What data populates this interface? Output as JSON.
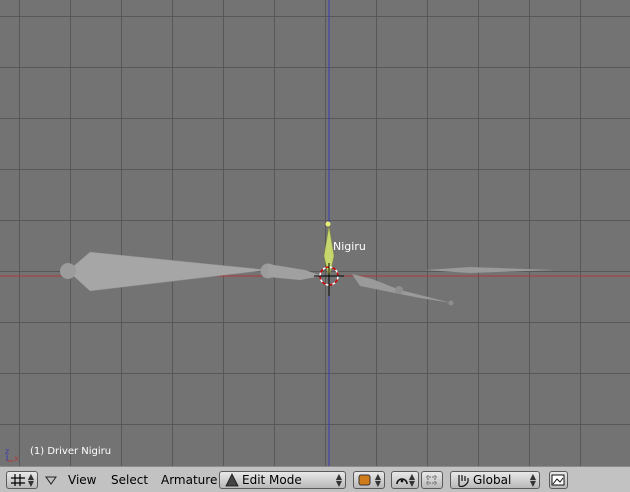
{
  "viewport": {
    "bone_label": "Nigiru",
    "status_text": "(1) Driver Nigiru",
    "axis_labels": {
      "z": "z",
      "x": "x"
    },
    "colors": {
      "background": "#737373",
      "grid": "#555555",
      "x_axis": "#b03a3a",
      "y_axis": "#3a3ab0",
      "bone": "#a6a6a6",
      "selected_bone": "#c8d66e"
    }
  },
  "header": {
    "window_type_icon": "grid-icon",
    "menus": [
      "View",
      "Select",
      "Armature"
    ],
    "mode": {
      "label": "Edit Mode",
      "icon": "armature-mode-icon"
    },
    "draw_type_icon": "shaded-icon",
    "pivot_icon": "pivot-icon",
    "snap_icon": "snap-icon",
    "manipulator_icon": "hand-icon",
    "orientation": "Global",
    "render_icon": "render-icon"
  }
}
